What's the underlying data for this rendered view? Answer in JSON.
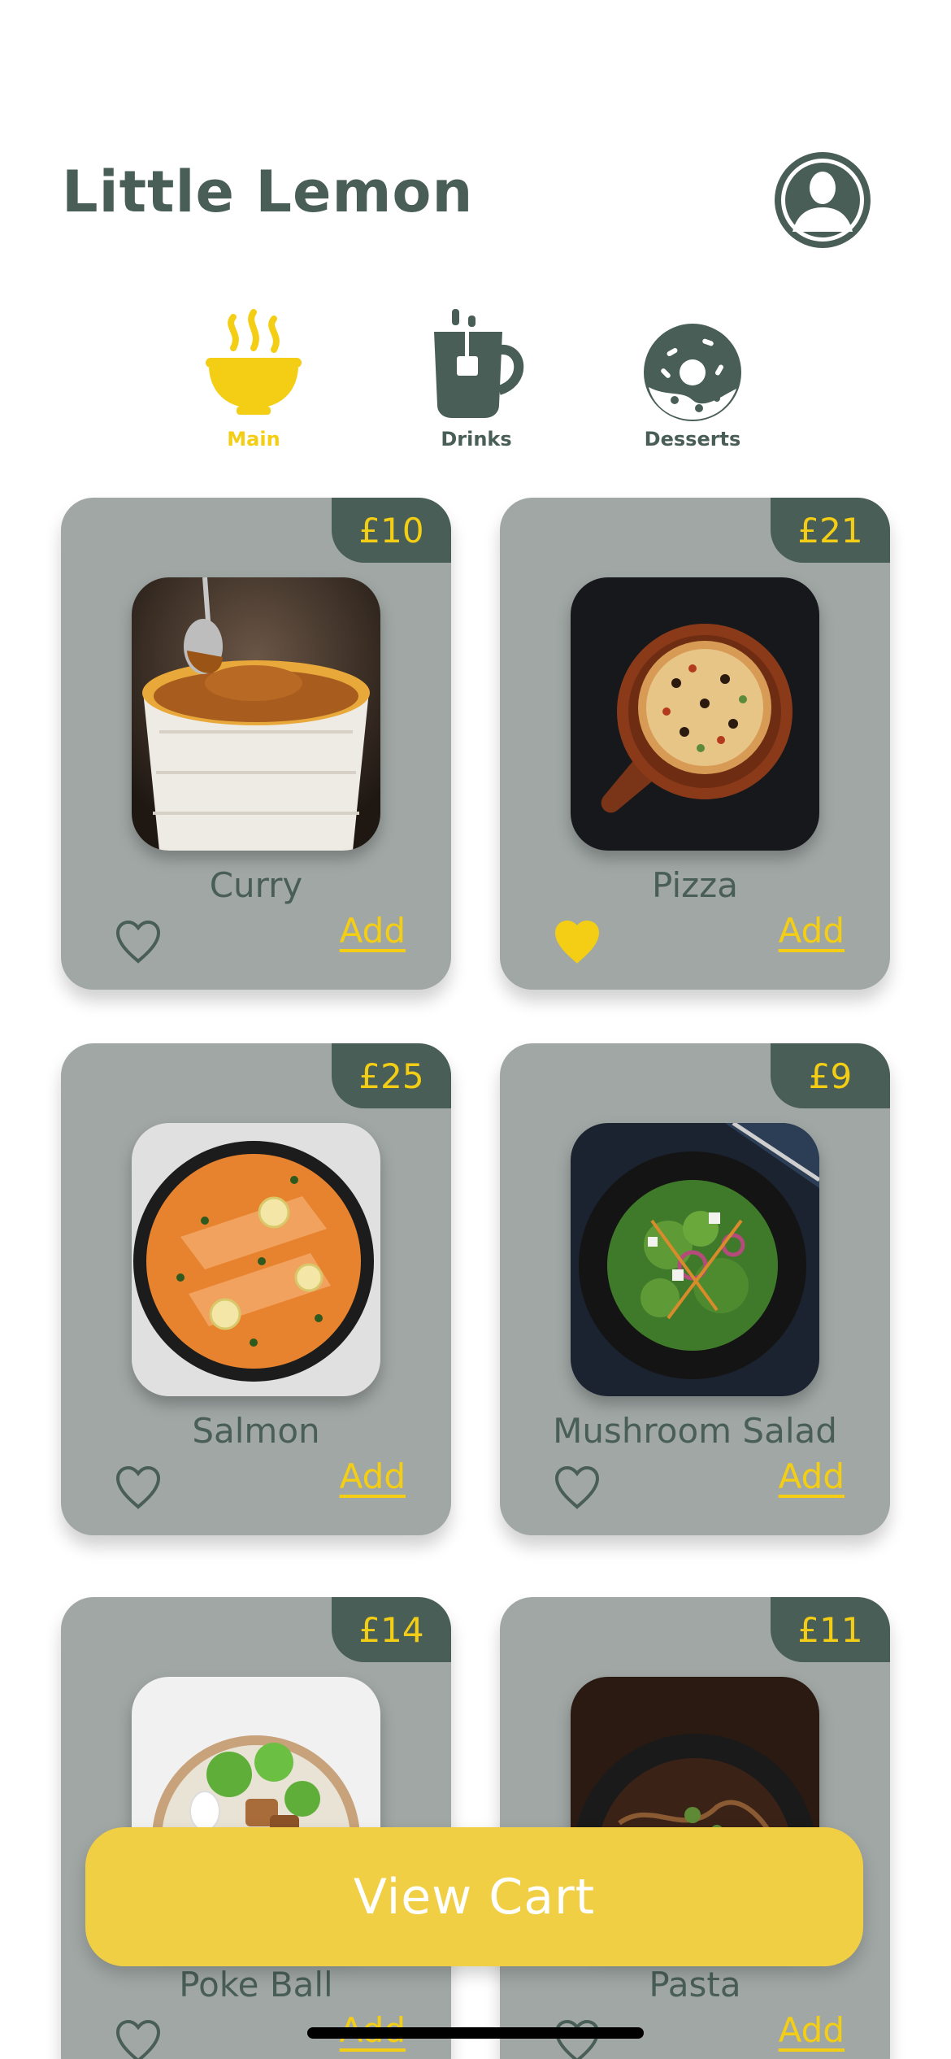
{
  "app": {
    "title": "Little Lemon"
  },
  "colors": {
    "primary": "#495e57",
    "accent": "#f4ce14",
    "card": "#a0a7a5",
    "button": "#f0cf44"
  },
  "tabs": [
    {
      "label": "Main",
      "icon": "bowl-icon",
      "active": true
    },
    {
      "label": "Drinks",
      "icon": "mug-icon",
      "active": false
    },
    {
      "label": "Desserts",
      "icon": "donut-icon",
      "active": false
    }
  ],
  "menu": [
    {
      "name": "Curry",
      "price": "£10",
      "favorite": false,
      "add_label": "Add"
    },
    {
      "name": "Pizza",
      "price": "£21",
      "favorite": true,
      "add_label": "Add"
    },
    {
      "name": "Salmon",
      "price": "£25",
      "favorite": false,
      "add_label": "Add"
    },
    {
      "name": "Mushroom Salad",
      "price": "£9",
      "favorite": false,
      "add_label": "Add"
    },
    {
      "name": "Poke Ball",
      "price": "£14",
      "favorite": false,
      "add_label": "Add"
    },
    {
      "name": "Pasta",
      "price": "£11",
      "favorite": false,
      "add_label": "Add"
    }
  ],
  "cart": {
    "label": "View Cart"
  }
}
